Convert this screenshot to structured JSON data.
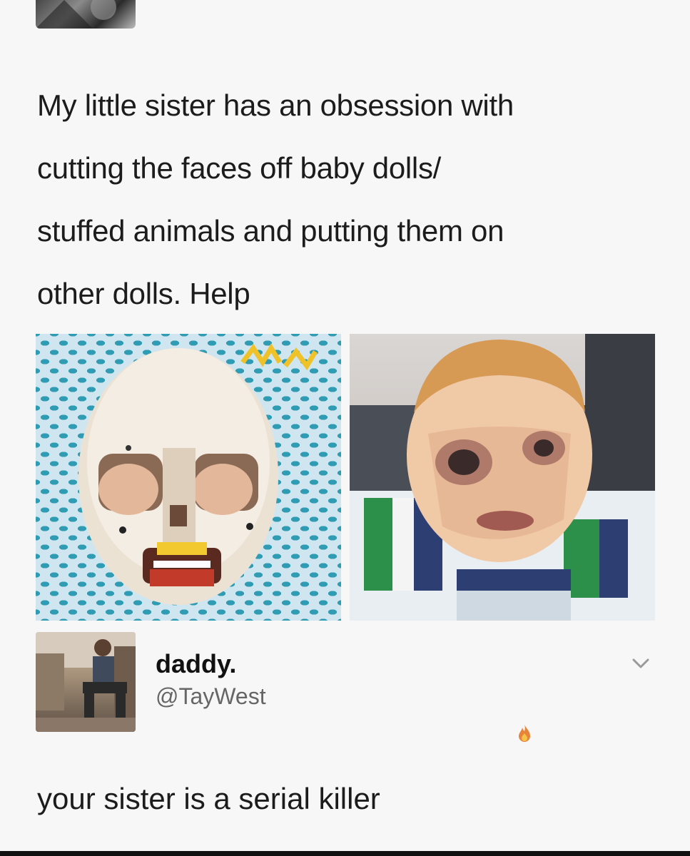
{
  "original_post": {
    "text": "My little sister has an obsession with\ncutting the faces off baby dolls/\nstuffed animals and putting them on\nother dolls. Help",
    "images": [
      {
        "icon": "doll-face-mask-photo",
        "description_label": ""
      },
      {
        "icon": "doll-with-face-photo",
        "description_label": ""
      }
    ]
  },
  "reply": {
    "display_name": "daddy.",
    "handle": "@TayWest",
    "text": "your sister is a serial killer",
    "icons": {
      "menu": "chevron-down-icon",
      "reaction": "fire-icon"
    }
  },
  "colors": {
    "background": "#f7f7f7",
    "text": "#1c1c1c",
    "handle": "#666666",
    "fire": "#e8833a"
  }
}
